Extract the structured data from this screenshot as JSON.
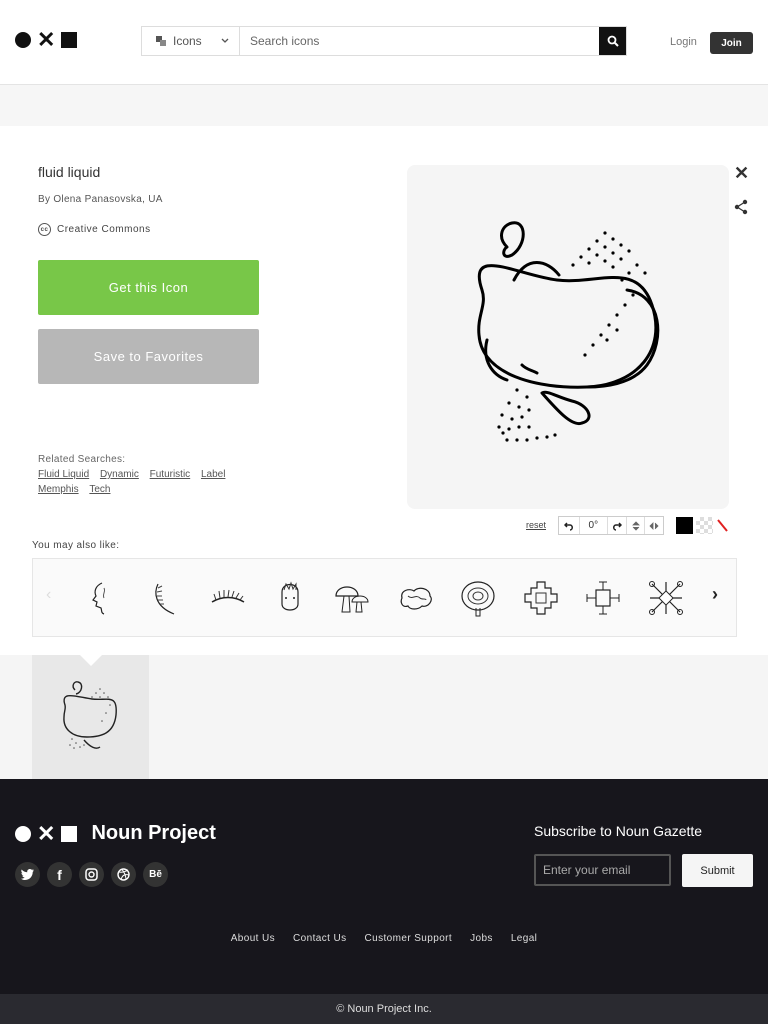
{
  "header": {
    "search_type": "Icons",
    "search_placeholder": "Search icons",
    "login_label": "Login",
    "join_label": "Join"
  },
  "icon_detail": {
    "title": "fluid liquid",
    "author": "By Olena Panasovska, UA",
    "license": "Creative Commons",
    "get_button": "Get this Icon",
    "favorites_button": "Save to Favorites",
    "related_label": "Related Searches:",
    "related_tags": [
      "Fluid Liquid",
      "Dynamic",
      "Futuristic",
      "Label",
      "Memphis",
      "Tech"
    ]
  },
  "toolbar": {
    "reset_label": "reset",
    "rotation": "0°",
    "colors": [
      "#000000",
      "transparent",
      "#e02020"
    ]
  },
  "also_like": {
    "label": "You may also like:",
    "thumbnails": [
      "face-profile-icon",
      "feather-icon",
      "eyelash-icon",
      "head-icon",
      "mushrooms-icon",
      "brain-icon",
      "mushroom-top-icon",
      "ornament-icon",
      "ornament-symbol-icon",
      "snowflake-ornament-icon"
    ]
  },
  "footer": {
    "brand": "Noun Project",
    "subscribe_title": "Subscribe to Noun Gazette",
    "email_placeholder": "Enter your email",
    "submit_label": "Submit",
    "socials": [
      "twitter-icon",
      "facebook-icon",
      "instagram-icon",
      "dribbble-icon",
      "behance-icon"
    ],
    "links": [
      "About Us",
      "Contact Us",
      "Customer Support",
      "Jobs",
      "Legal"
    ],
    "copyright": "© Noun Project Inc."
  }
}
